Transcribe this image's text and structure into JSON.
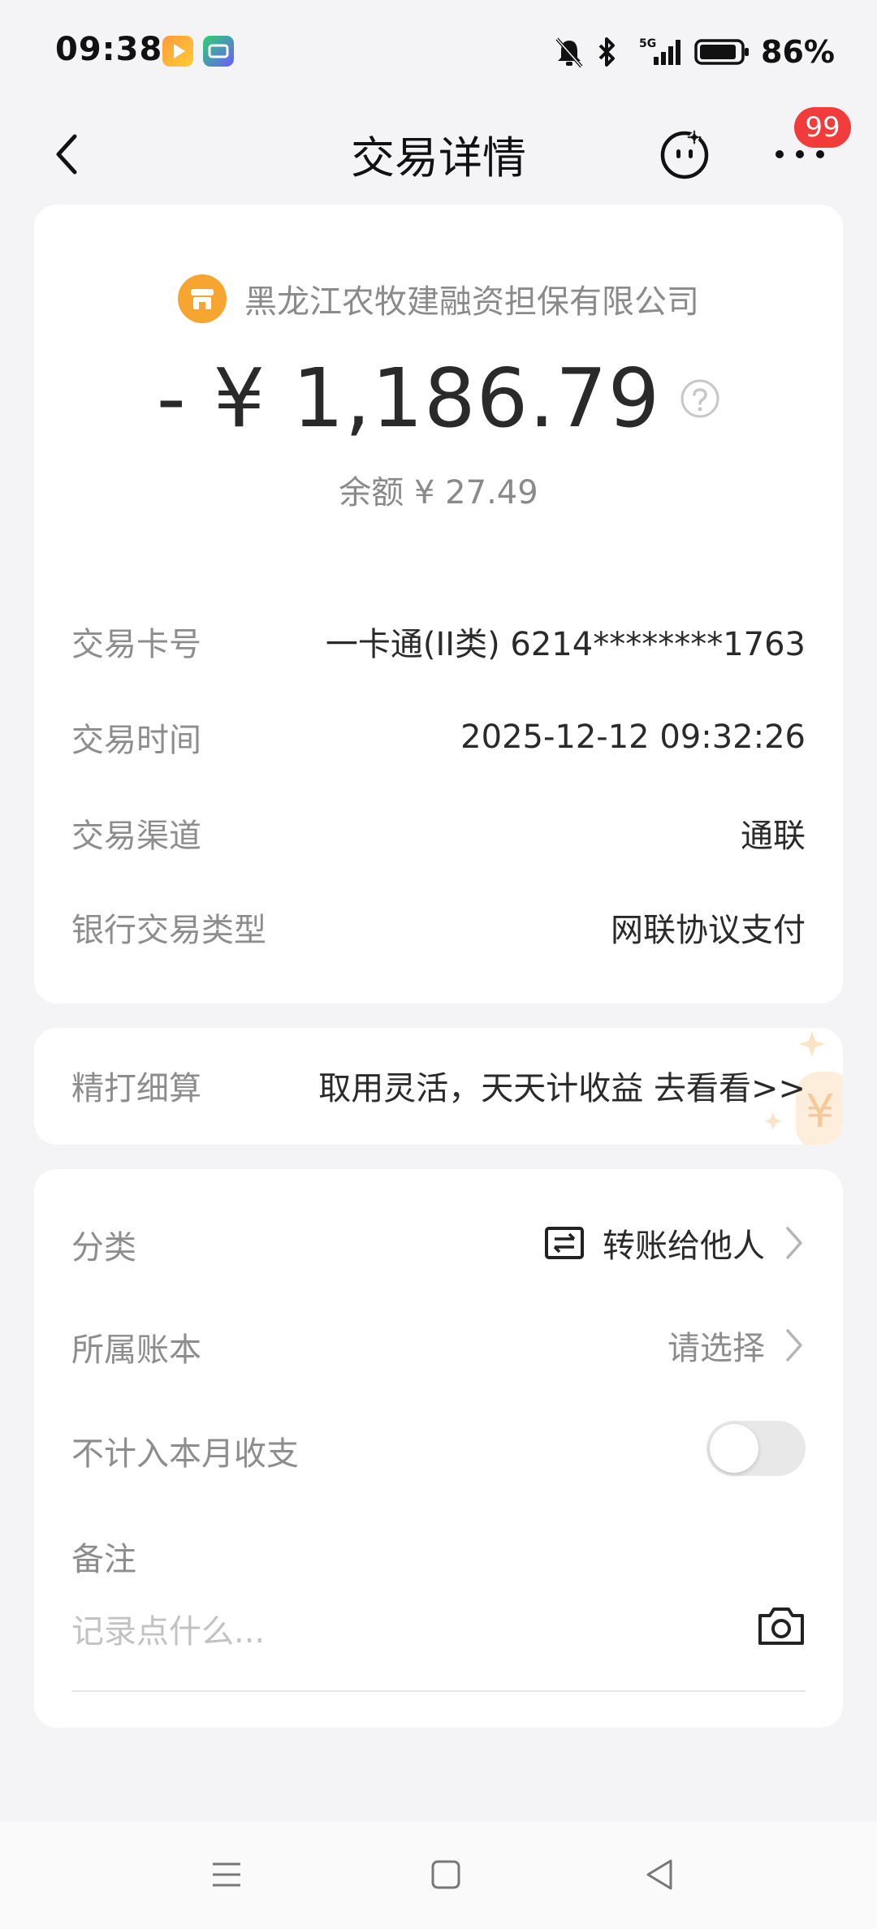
{
  "status_bar": {
    "time": "09:38",
    "battery_percent": "86%",
    "apps": [
      "video-app-icon",
      "iqiyi-app-icon"
    ]
  },
  "header": {
    "title": "交易详情",
    "notification_count": "99"
  },
  "summary": {
    "merchant": "黑龙江农牧建融资担保有限公司",
    "amount": "- ¥ 1,186.79",
    "balance": "余额 ¥ 27.49"
  },
  "details": [
    {
      "label": "交易卡号",
      "value": "一卡通(II类) 6214********1763"
    },
    {
      "label": "交易时间",
      "value": "2025-12-12 09:32:26"
    },
    {
      "label": "交易渠道",
      "value": "通联"
    },
    {
      "label": "银行交易类型",
      "value": "网联协议支付"
    }
  ],
  "promo": {
    "label": "精打细算",
    "text": "取用灵活，天天计收益 去看看>>"
  },
  "settings": {
    "category_label": "分类",
    "category_value": "转账给他人",
    "ledger_label": "所属账本",
    "ledger_value": "请选择",
    "exclude_label": "不计入本月收支",
    "exclude_enabled": false,
    "note_label": "备注",
    "note_placeholder": "记录点什么..."
  },
  "colors": {
    "accent_badge": "#f23b3b",
    "merchant_icon": "#f6a531",
    "background": "#f4f4f6"
  }
}
